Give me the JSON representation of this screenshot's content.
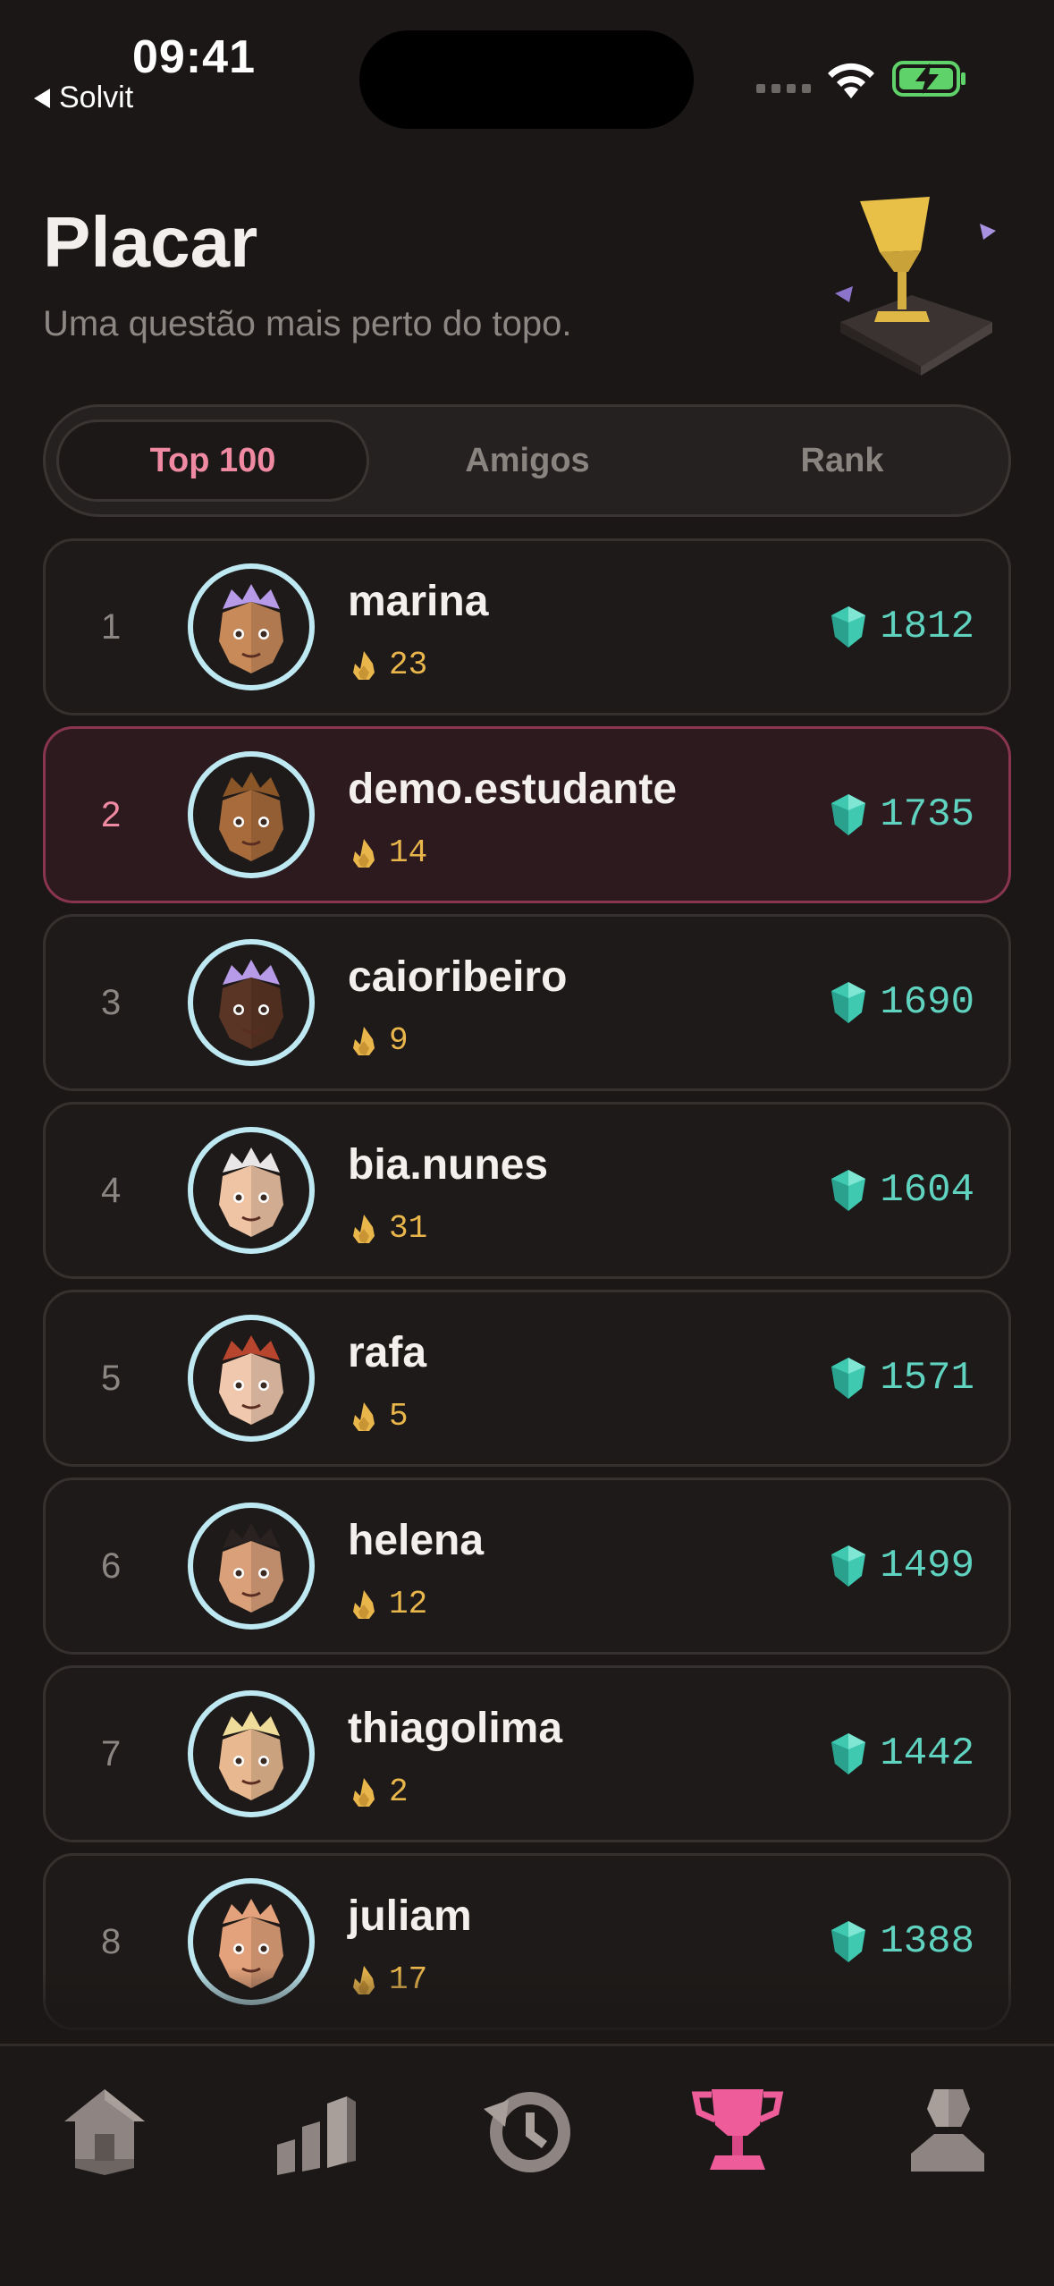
{
  "status_bar": {
    "time": "09:41",
    "back_label": "Solvit"
  },
  "header": {
    "title": "Placar",
    "subtitle": "Uma questão mais perto do topo."
  },
  "tabs": [
    {
      "label": "Top 100",
      "active": true
    },
    {
      "label": "Amigos",
      "active": false
    },
    {
      "label": "Rank",
      "active": false
    }
  ],
  "leaderboard": [
    {
      "rank": "1",
      "username": "marina",
      "streak": "23",
      "gems": "1812",
      "hair": "#b79be8",
      "skin": "#c98a5a"
    },
    {
      "rank": "2",
      "username": "demo.estudante",
      "streak": "14",
      "gems": "1735",
      "hair": "#8a5628",
      "skin": "#a86b3c",
      "is_current_user": true
    },
    {
      "rank": "3",
      "username": "caioribeiro",
      "streak": "9",
      "gems": "1690",
      "hair": "#b79be8",
      "skin": "#5a3424"
    },
    {
      "rank": "4",
      "username": "bia.nunes",
      "streak": "31",
      "gems": "1604",
      "hair": "#e8e6e6",
      "skin": "#efc4a4"
    },
    {
      "rank": "5",
      "username": "rafa",
      "streak": "5",
      "gems": "1571",
      "hair": "#b8452e",
      "skin": "#f0c8ad"
    },
    {
      "rank": "6",
      "username": "helena",
      "streak": "12",
      "gems": "1499",
      "hair": "#2a2220",
      "skin": "#d9a07a"
    },
    {
      "rank": "7",
      "username": "thiagolima",
      "streak": "2",
      "gems": "1442",
      "hair": "#f0dc9a",
      "skin": "#e8b990"
    },
    {
      "rank": "8",
      "username": "juliam",
      "streak": "17",
      "gems": "1388",
      "hair": "#e3a27c",
      "skin": "#e3a27c"
    }
  ],
  "colors": {
    "background": "#1a1716",
    "accent_pink": "#f08aa3",
    "gem_teal": "#5fd3bf",
    "streak_gold": "#e9b64c",
    "avatar_ring": "#bfe9f2"
  },
  "nav": [
    {
      "icon": "home-icon",
      "active": false
    },
    {
      "icon": "stats-icon",
      "active": false
    },
    {
      "icon": "history-icon",
      "active": false
    },
    {
      "icon": "trophy-icon",
      "active": true
    },
    {
      "icon": "profile-icon",
      "active": false
    }
  ]
}
